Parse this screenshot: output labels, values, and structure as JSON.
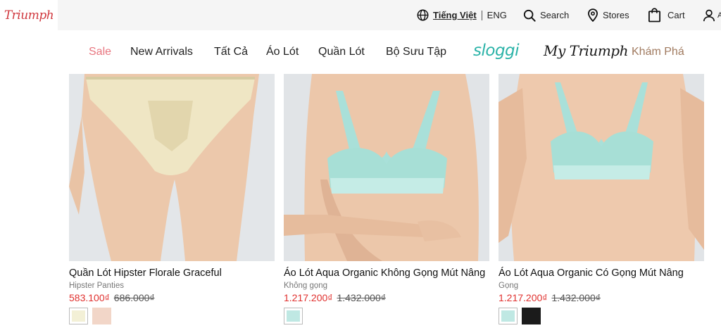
{
  "header": {
    "logo_text": "Triumph",
    "language_active": "Tiếng Việt",
    "language_alt": "ENG",
    "search_label": "Search",
    "stores_label": "Stores",
    "cart_label": "Cart",
    "account_label": "A"
  },
  "nav": {
    "items": [
      "Sale",
      "New Arrivals",
      "Tất Cả",
      "Áo Lót",
      "Quần Lót",
      "Bộ Sưu Tập"
    ],
    "brand_sloggi": "sloggi",
    "brand_mytriumph": "My Triumph",
    "explore": "Khám Phá"
  },
  "colors": {
    "sale": "#e8757f",
    "price": "#e0302e",
    "explore": "#a07a5f",
    "sloggi": "#2bb3a8",
    "logo": "#d0383e"
  },
  "products": [
    {
      "title": "Quần Lót Hipster Florale Graceful",
      "subtitle": "Hipster Panties",
      "price": "583.100₫",
      "old_price": "686.000₫",
      "image": "beige lace hipster panties photo"
    },
    {
      "title": "Áo Lót Aqua Organic Không Gọng Mút Nâng",
      "subtitle": "Không gọng",
      "price": "1.217.200₫",
      "old_price": "1.432.000₫",
      "image": "aqua lace wireless bra photo"
    },
    {
      "title": "Áo Lót Aqua Organic Có Gọng Mút Nâng",
      "subtitle": "Gọng",
      "price": "1.217.200₫",
      "old_price": "1.432.000₫",
      "image": "aqua lace underwire bra photo"
    }
  ]
}
